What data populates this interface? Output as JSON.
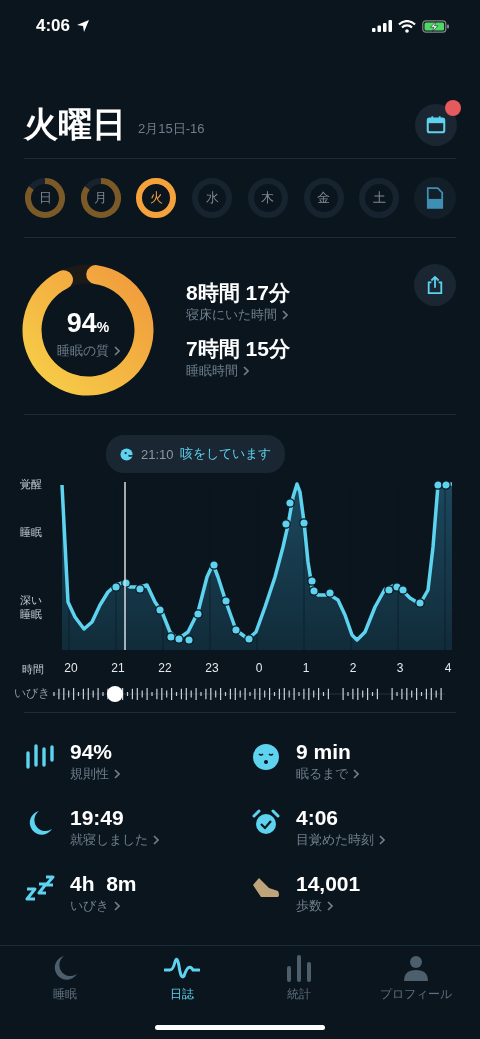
{
  "status_bar": {
    "time": "4:06"
  },
  "header": {
    "title": "火曜日",
    "date_range": "2月15日-16",
    "calendar_badge": true
  },
  "days": [
    {
      "label": "日",
      "selected": false
    },
    {
      "label": "月",
      "selected": false
    },
    {
      "label": "火",
      "selected": true
    },
    {
      "label": "水",
      "selected": false
    },
    {
      "label": "木",
      "selected": false
    },
    {
      "label": "金",
      "selected": false
    },
    {
      "label": "土",
      "selected": false
    }
  ],
  "summary": {
    "quality": {
      "value": "94",
      "unit": "%",
      "label": "睡眠の質"
    },
    "metrics": [
      {
        "value": "8時間 17分",
        "label": "寝床にいた時間"
      },
      {
        "value": "7時間 15分",
        "label": "睡眠時間"
      }
    ]
  },
  "graph": {
    "tooltip": {
      "time": "21:10",
      "text": "咳をしています"
    },
    "y_labels": [
      "覚醒",
      "睡眠",
      "深い睡眠"
    ],
    "x_title": "時間",
    "x_labels": [
      "20",
      "21",
      "22",
      "23",
      "0",
      "1",
      "2",
      "3",
      "4"
    ],
    "snore_label": "いびき"
  },
  "stats": [
    {
      "value": "94%",
      "label": "規則性"
    },
    {
      "value": "9 min",
      "label": "眠るまで"
    },
    {
      "value": "19:49",
      "label": "就寝しました"
    },
    {
      "value": "4:06",
      "label": "目覚めた時刻"
    },
    {
      "value": "4h  8m",
      "label": "いびき"
    },
    {
      "value": "14,001",
      "label": "歩数"
    }
  ],
  "tab_bar": [
    {
      "label": "睡眠",
      "selected": false
    },
    {
      "label": "日誌",
      "selected": true
    },
    {
      "label": "統計",
      "selected": false
    },
    {
      "label": "プロフィール",
      "selected": false
    }
  ]
}
